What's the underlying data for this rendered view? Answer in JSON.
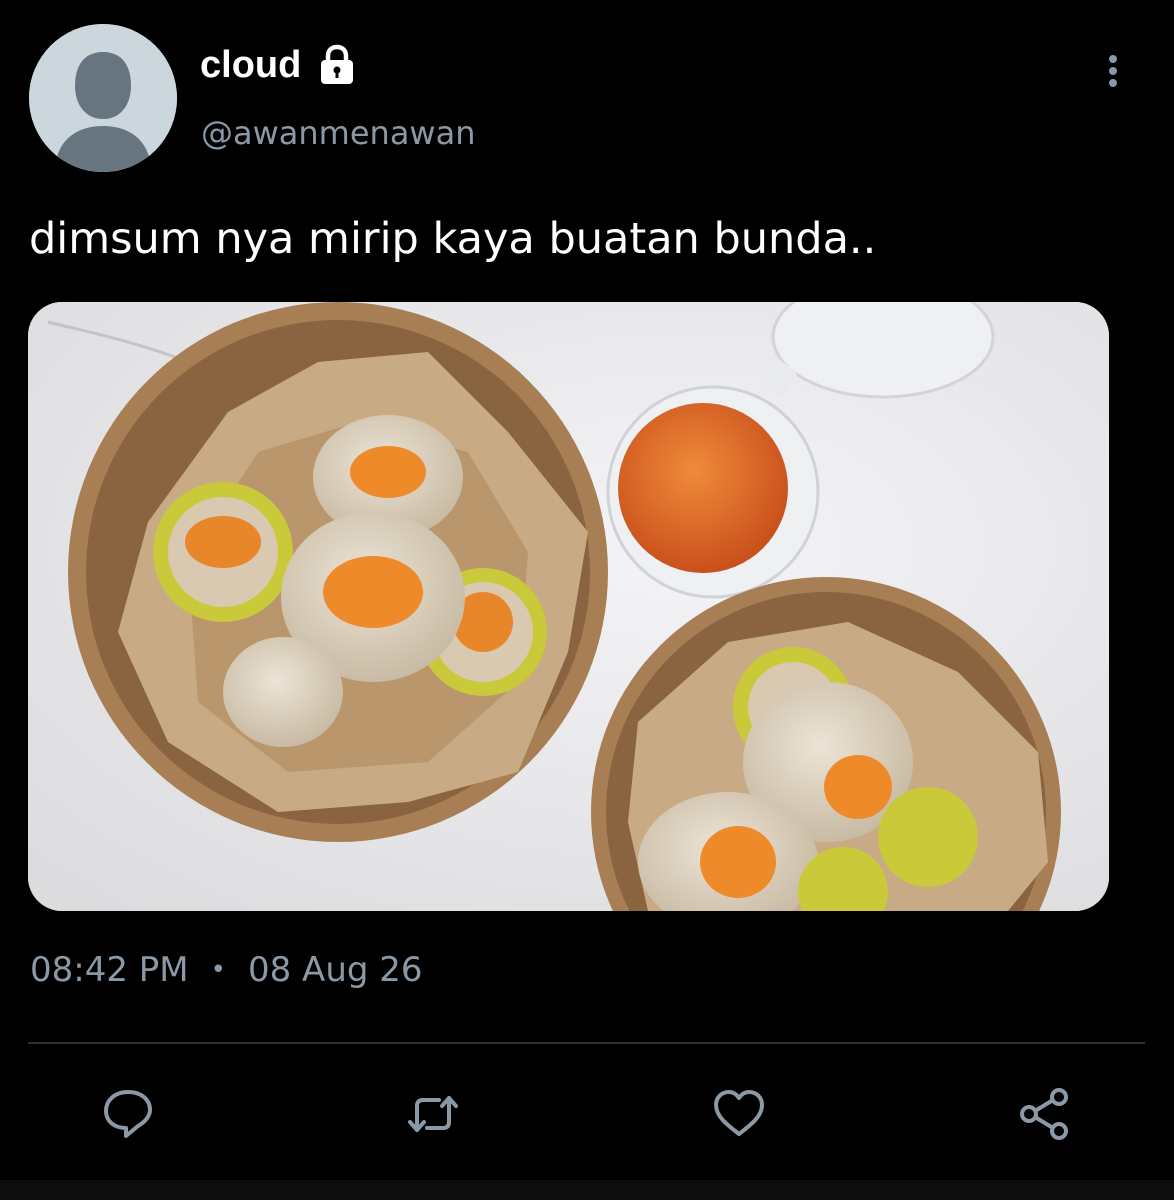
{
  "author": {
    "display_name": "cloud",
    "handle": "@awanmenawan",
    "protected_icon": "lock-icon",
    "avatar_icon": "default-avatar-silhouette"
  },
  "tweet": {
    "text": "dimsum nya mirip kaya buatan bunda..",
    "media_description_icon": "photo",
    "time": "08:42 PM",
    "separator": "•",
    "date": "08 Aug 26"
  },
  "actions": [
    {
      "name": "reply",
      "icon": "speech-bubble-icon"
    },
    {
      "name": "retweet",
      "icon": "retweet-icon"
    },
    {
      "name": "like",
      "icon": "heart-icon"
    },
    {
      "name": "share",
      "icon": "share-icon"
    }
  ],
  "colors": {
    "background": "#000000",
    "text_primary": "#ffffff",
    "text_secondary": "#8b98a5",
    "divider": "#2a2f33",
    "avatar_bg": "#ccd6dd",
    "avatar_figure": "#66757f"
  }
}
